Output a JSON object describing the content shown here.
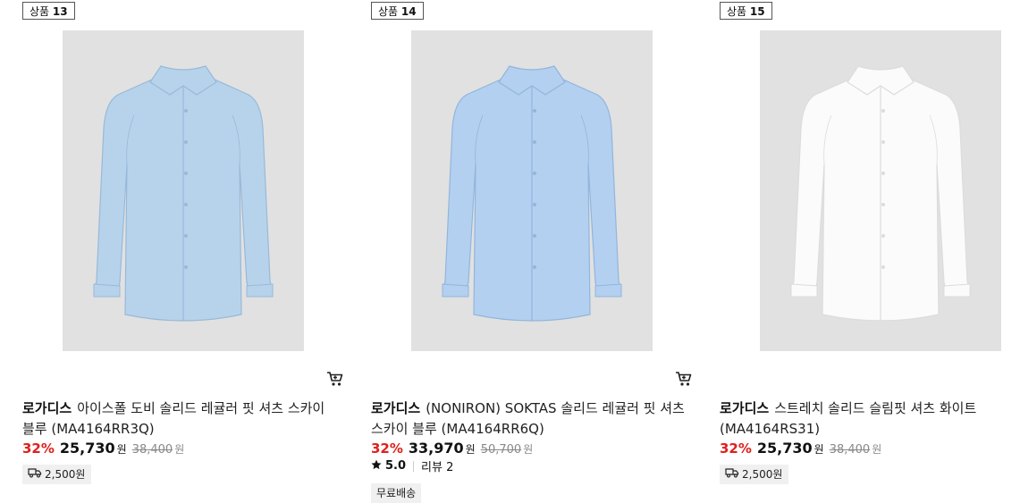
{
  "products": [
    {
      "badge_label": "상품",
      "badge_num": "13",
      "image_alt": "light blue dress shirt",
      "brand": "로가디스",
      "name": "아이스폴 도비 솔리드 레귤러 핏 셔츠 스카이 블루 (MA4164RR3Q)",
      "discount": "32%",
      "price": "25,730",
      "won": "원",
      "original_price": "38,400",
      "original_won": "원",
      "shipping_fee": "2,500원",
      "shirt_color": "#b7d3ec",
      "shirt_shadow": "#98b9d8"
    },
    {
      "badge_label": "상품",
      "badge_num": "14",
      "image_alt": "sky blue dress shirt",
      "brand": "로가디스",
      "name": "(NONIRON) SOKTAS 솔리드 레귤러 핏 셔츠 스카이 블루 (MA4164RR6Q)",
      "discount": "32%",
      "price": "33,970",
      "won": "원",
      "original_price": "50,700",
      "original_won": "원",
      "rating": "5.0",
      "review": "리뷰 2",
      "free_shipping": "무료배송",
      "shirt_color": "#b3d0f0",
      "shirt_shadow": "#92b5dc"
    },
    {
      "badge_label": "상품",
      "badge_num": "15",
      "image_alt": "white dress shirt",
      "brand": "로가디스",
      "name": "스트레치 솔리드 슬림핏 셔츠 화이트 (MA4164RS31)",
      "discount": "32%",
      "price": "25,730",
      "won": "원",
      "original_price": "38,400",
      "original_won": "원",
      "shipping_fee": "2,500원",
      "shirt_color": "#fbfbfb",
      "shirt_shadow": "#dcdcdc"
    }
  ],
  "icons": {
    "cart": "cart-icon",
    "truck": "truck-icon",
    "star": "star-icon"
  }
}
